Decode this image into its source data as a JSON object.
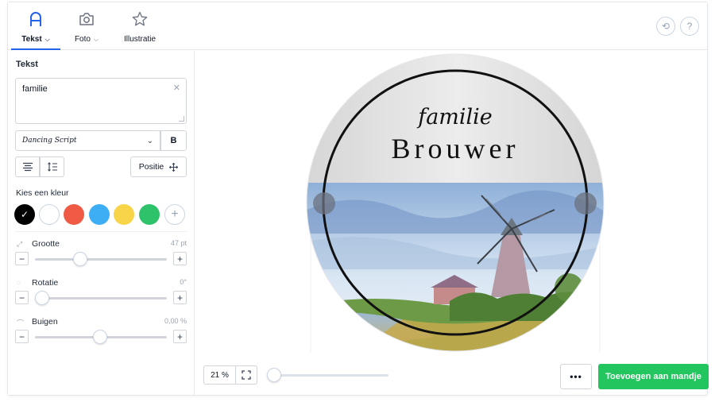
{
  "tabs": [
    {
      "label": "Tekst",
      "icon": "text-a-icon",
      "active": true,
      "has_dropdown": true
    },
    {
      "label": "Foto",
      "icon": "camera-icon",
      "active": false,
      "has_dropdown": true
    },
    {
      "label": "Illustratie",
      "icon": "star-icon",
      "active": false,
      "has_dropdown": false
    }
  ],
  "header_actions": [
    {
      "icon": "refresh-icon"
    },
    {
      "icon": "help-icon"
    }
  ],
  "sidebar": {
    "title": "Tekst",
    "text_value": "familie",
    "font_name": "Dancing Script",
    "bold_label": "B",
    "position_label": "Positie",
    "colors_label": "Kies een kleur",
    "colors": [
      "#000000",
      "#ffffff",
      "#ef5a45",
      "#3eaef4",
      "#f8d548",
      "#2ec26b"
    ],
    "selected_color": "#000000",
    "properties": [
      {
        "label": "Grootte",
        "value": "47 pt",
        "icon": "resize-icon",
        "slider_fraction": 0.34
      },
      {
        "label": "Rotatie",
        "value": "0°",
        "icon": "rotate-icon",
        "slider_fraction": 0.0
      },
      {
        "label": "Buigen",
        "value": "0,00 %",
        "icon": "arc-icon",
        "slider_fraction": 0.5
      }
    ]
  },
  "design": {
    "line1": "familie",
    "line2": "Brouwer"
  },
  "bottom": {
    "zoom": "21 %",
    "zoom_slider_fraction": 0.0,
    "more_label": "•••",
    "add_to_cart": "Toevoegen aan mandje"
  },
  "colors": {
    "accent": "#2563eb",
    "cta": "#22c55e"
  }
}
